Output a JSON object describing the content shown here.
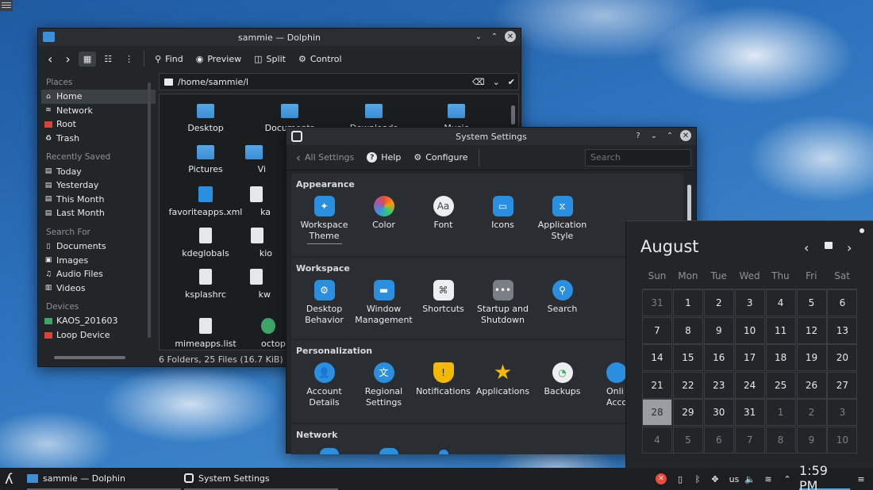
{
  "dolphin": {
    "title": "sammie — Dolphin",
    "toolbar": {
      "find": "Find",
      "preview": "Preview",
      "split": "Split",
      "control": "Control"
    },
    "location": "/home/sammie/l",
    "sidebar": {
      "places_label": "Places",
      "places": [
        "Home",
        "Network",
        "Root",
        "Trash"
      ],
      "recent_label": "Recently Saved",
      "recent": [
        "Today",
        "Yesterday",
        "This Month",
        "Last Month"
      ],
      "search_label": "Search For",
      "search": [
        "Documents",
        "Images",
        "Audio Files",
        "Videos"
      ],
      "devices_label": "Devices",
      "devices": [
        "KAOS_201603",
        "Loop Device"
      ]
    },
    "files": [
      "Desktop",
      "Documents",
      "Downloads",
      "Music",
      "Pictures",
      "Vi",
      "favoriteapps.xml",
      "ka",
      "kdeglobals",
      "kio",
      "ksplashrc",
      "kw",
      "mimeapps.list",
      "octop"
    ],
    "status": "6 Folders, 25 Files (16.7 KiB)"
  },
  "settings": {
    "title": "System Settings",
    "nav": {
      "all": "All Settings",
      "help": "Help",
      "configure": "Configure"
    },
    "search_placeholder": "Search",
    "appearance": {
      "label": "Appearance",
      "items": [
        "Workspace Theme",
        "Color",
        "Font",
        "Icons",
        "Application Style"
      ]
    },
    "workspace": {
      "label": "Workspace",
      "items": [
        "Desktop Behavior",
        "Window Management",
        "Shortcuts",
        "Startup and Shutdown",
        "Search"
      ]
    },
    "personalization": {
      "label": "Personalization",
      "items": [
        "Account Details",
        "Regional Settings",
        "Notifications",
        "Applications",
        "Backups",
        "Onli Accou"
      ]
    },
    "network": {
      "label": "Network"
    }
  },
  "calendar": {
    "month": "August",
    "days": [
      "Sun",
      "Mon",
      "Tue",
      "Wed",
      "Thu",
      "Fri",
      "Sat"
    ],
    "weeks": [
      [
        "31",
        "1",
        "2",
        "3",
        "4",
        "5",
        "6"
      ],
      [
        "7",
        "8",
        "9",
        "10",
        "11",
        "12",
        "13"
      ],
      [
        "14",
        "15",
        "16",
        "17",
        "18",
        "19",
        "20"
      ],
      [
        "21",
        "22",
        "23",
        "24",
        "25",
        "26",
        "27"
      ],
      [
        "28",
        "29",
        "30",
        "31",
        "1",
        "2",
        "3"
      ],
      [
        "4",
        "5",
        "6",
        "7",
        "8",
        "9",
        "10"
      ]
    ],
    "today": "28"
  },
  "taskbar": {
    "tasks": [
      "sammie — Dolphin",
      "System Settings"
    ],
    "keyboard": "us",
    "clock": "1:59 PM"
  },
  "colors": {
    "accent": "#3daee9",
    "panel": "#232629"
  }
}
